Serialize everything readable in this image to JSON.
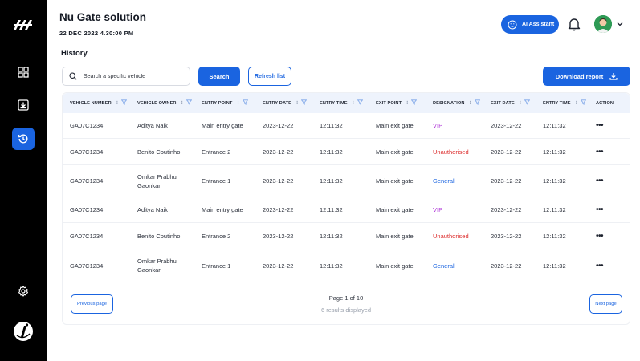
{
  "header": {
    "title": "Nu Gate solution",
    "date": "22 DEC 2022 4.30:00 PM",
    "ai_label": "AI Assistant"
  },
  "section": {
    "title": "History"
  },
  "toolbar": {
    "search_placeholder": "Search a specific vehicle",
    "search_label": "Search",
    "refresh_label": "Refresh list",
    "download_label": "Download report"
  },
  "columns": [
    "Vehicle number",
    "Vehicle owner",
    "Entry point",
    "Entry date",
    "Entry time",
    "Exit point",
    "Designation",
    "Exit date",
    "Entry time",
    "Action"
  ],
  "rows": [
    {
      "vehicle": "GA07C1234",
      "owner": "Aditya Naik",
      "entry_point": "Main entry gate",
      "entry_date": "2023-12-22",
      "entry_time": "12:11:32",
      "exit_point": "Main exit gate",
      "designation": "VIP",
      "exit_date": "2023-12-22",
      "exit_time": "12:11:32",
      "action": "•••"
    },
    {
      "vehicle": "GA07C1234",
      "owner": "Benito Coutinho",
      "entry_point": "Entrance 2",
      "entry_date": "2023-12-22",
      "entry_time": "12:11:32",
      "exit_point": "Main exit gate",
      "designation": "Unauthorised",
      "exit_date": "2023-12-22",
      "exit_time": "12:11:32",
      "action": "•••"
    },
    {
      "vehicle": "GA07C1234",
      "owner": "Omkar Prabhu Gaonkar",
      "entry_point": "Entrance 1",
      "entry_date": "2023-12-22",
      "entry_time": "12:11:32",
      "exit_point": "Main exit gate",
      "designation": "General",
      "exit_date": "2023-12-22",
      "exit_time": "12:11:32",
      "action": "•••"
    },
    {
      "vehicle": "GA07C1234",
      "owner": "Aditya Naik",
      "entry_point": "Main entry gate",
      "entry_date": "2023-12-22",
      "entry_time": "12:11:32",
      "exit_point": "Main exit gate",
      "designation": "VIP",
      "exit_date": "2023-12-22",
      "exit_time": "12:11:32",
      "action": "•••"
    },
    {
      "vehicle": "GA07C1234",
      "owner": "Benito Coutinho",
      "entry_point": "Entrance 2",
      "entry_date": "2023-12-22",
      "entry_time": "12:11:32",
      "exit_point": "Main exit gate",
      "designation": "Unauthorised",
      "exit_date": "2023-12-22",
      "exit_time": "12:11:32",
      "action": "•••"
    },
    {
      "vehicle": "GA07C1234",
      "owner": "Omkar Prabhu Gaonkar",
      "entry_point": "Entrance 1",
      "entry_date": "2023-12-22",
      "entry_time": "12:11:32",
      "exit_point": "Main exit gate",
      "designation": "General",
      "exit_date": "2023-12-22",
      "exit_time": "12:11:32",
      "action": "•••"
    }
  ],
  "pagination": {
    "prev_label": "Previous page",
    "next_label": "Next page",
    "page_text": "Page 1 of 10",
    "results_text": "6 results displayed"
  },
  "colors": {
    "accent": "#1a64e0",
    "vip": "#b03ad8",
    "unauthorised": "#dc2b2b",
    "general": "#1a64e0",
    "sidebar": "#000000"
  },
  "icons": {
    "sidebar": [
      "dashboard-icon",
      "download-box-icon",
      "history-icon",
      "settings-icon"
    ]
  }
}
